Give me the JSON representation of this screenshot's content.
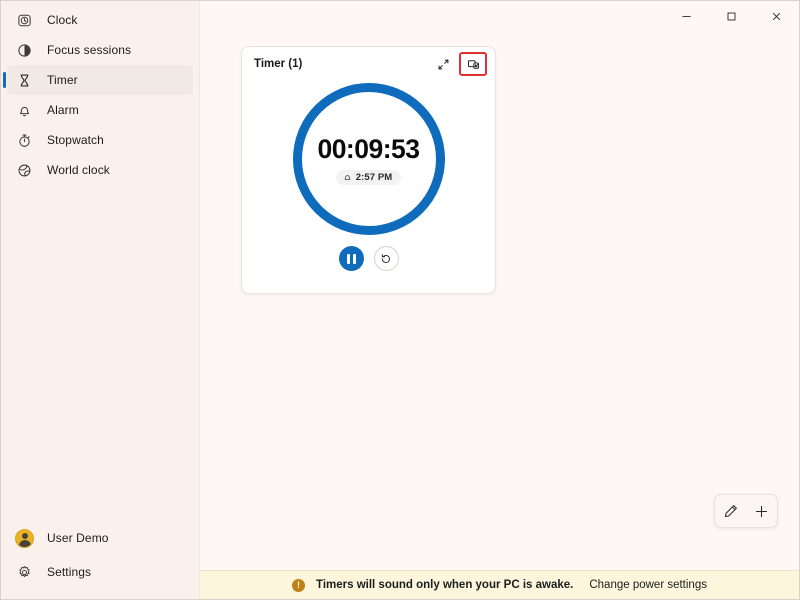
{
  "app": {
    "title": "Clock",
    "accent_color": "#0f6cbd",
    "sidebar_bg": "#faf1ec",
    "content_bg": "#fdf7f5",
    "highlight_color": "#e03131"
  },
  "window_controls": {
    "minimize": "─",
    "maximize": "□",
    "close": "✕"
  },
  "sidebar": {
    "title_item": {
      "label": "Clock",
      "icon": "clock-icon"
    },
    "items": [
      {
        "label": "Focus sessions",
        "icon": "focus-sessions-icon",
        "selected": false
      },
      {
        "label": "Timer",
        "icon": "hourglass-icon",
        "selected": true
      },
      {
        "label": "Alarm",
        "icon": "bell-icon",
        "selected": false
      },
      {
        "label": "Stopwatch",
        "icon": "stopwatch-icon",
        "selected": false
      },
      {
        "label": "World clock",
        "icon": "globe-icon",
        "selected": false
      }
    ],
    "bottom_items": [
      {
        "label": "User Demo",
        "icon": "avatar"
      },
      {
        "label": "Settings",
        "icon": "gear-icon"
      }
    ]
  },
  "timer_card": {
    "title": "Timer (1)",
    "expand_label": "expand-icon",
    "pin_label": "compact-overlay-icon",
    "time_remaining": "00:09:53",
    "end_time": "2:57 PM",
    "end_time_icon": "alarm-bell-icon",
    "ring_color": "#0f6cbd",
    "pause_label": "pause-button",
    "reset_label": "reset-button"
  },
  "fab": {
    "edit_label": "edit-timers-button",
    "add_label": "add-timer-button"
  },
  "statusbar": {
    "warning_glyph": "!",
    "message": "Timers will sound only when your PC is awake.",
    "link": "Change power settings"
  }
}
